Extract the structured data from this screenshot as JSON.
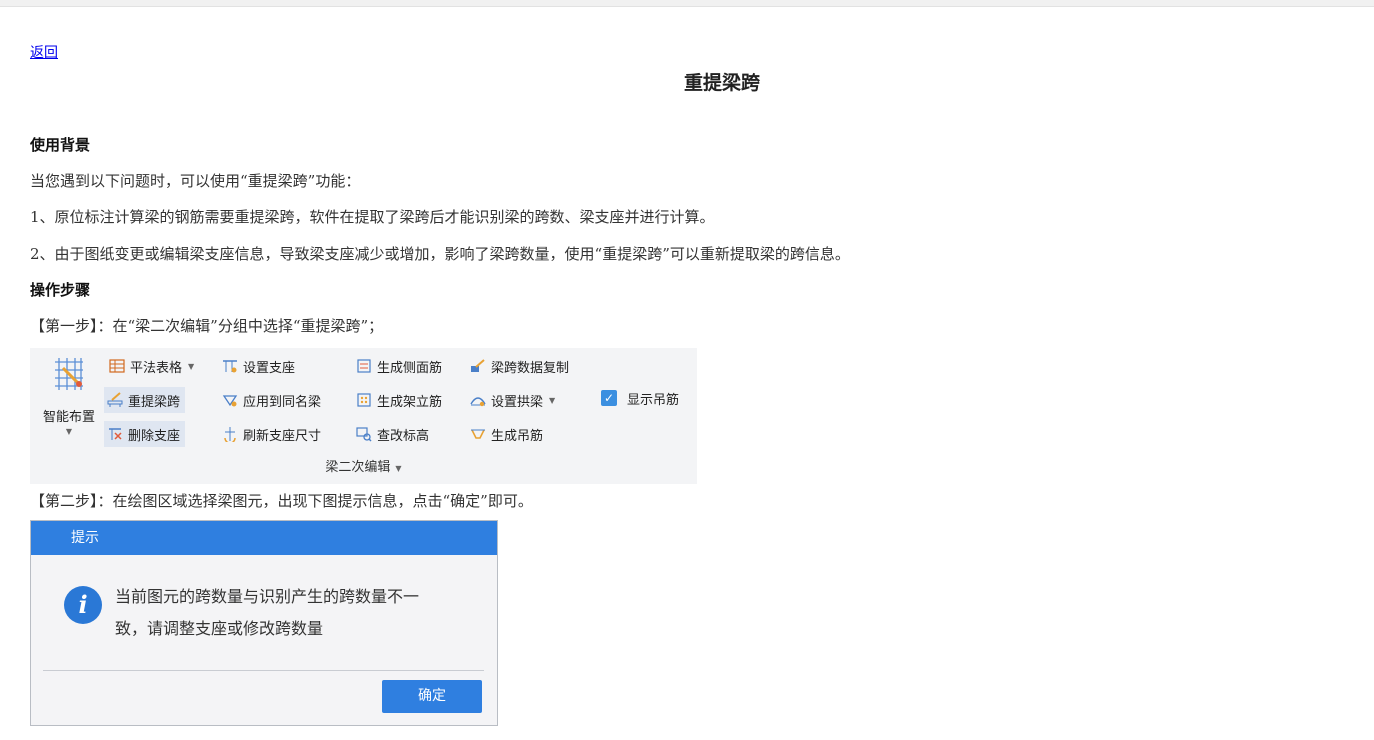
{
  "back_link": "返回",
  "title": "重提梁跨",
  "section1_heading": "使用背景",
  "intro": "当您遇到以下问题时，可以使用“重提梁跨”功能：",
  "items": [
    "1、原位标注计算梁的钢筋需要重提梁跨，软件在提取了梁跨后才能识别梁的跨数、梁支座并进行计算。",
    "2、由于图纸变更或编辑梁支座信息，导致梁支座减少或增加，影响了梁跨数量，使用“重提梁跨”可以重新提取梁的跨信息。"
  ],
  "section2_heading": "操作步骤",
  "step1": "【第一步】：在“梁二次编辑”分组中选择“重提梁跨”；",
  "step2": "【第二步】：在绘图区域选择梁图元，出现下图提示信息，点击“确定”即可。",
  "ribbon": {
    "big_button": "智能布置",
    "col1": [
      "平法表格",
      "重提梁跨",
      "删除支座"
    ],
    "col2": [
      "设置支座",
      "应用到同名梁",
      "刷新支座尺寸"
    ],
    "col3": [
      "生成侧面筋",
      "生成架立筋",
      "查改标高"
    ],
    "col4": [
      "梁跨数据复制",
      "设置拱梁",
      "生成吊筋"
    ],
    "checkbox": "显示吊筋",
    "group_label": "梁二次编辑"
  },
  "dialog": {
    "title": "提示",
    "icon": "i",
    "message_line1": "当前图元的跨数量与识别产生的跨数量不一",
    "message_line2": "致，请调整支座或修改跨数量",
    "ok": "确定"
  },
  "colors": {
    "link": "#0000ee",
    "dialog_blue": "#2f7fe0",
    "ribbon_bg": "#f3f4f6"
  }
}
